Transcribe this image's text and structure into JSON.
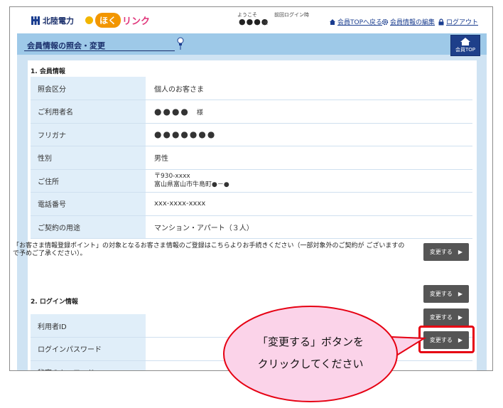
{
  "header": {
    "company": "北陸電力",
    "brand_badge": "ほく",
    "brand_rest": "リンク",
    "welcome": "ようこそ",
    "user_masked": "●●●●",
    "user_suffix": "様",
    "last_login_label": "前回ログイン時",
    "links": {
      "member_top": "会員TOPへ戻る",
      "edit_member": "会員情報の編集",
      "logout": "ログアウト"
    }
  },
  "page": {
    "title": "会員情報の照会・変更",
    "top_button": "会員TOP"
  },
  "section1": {
    "title": "1. 会員情報",
    "rows": [
      {
        "label": "照会区分",
        "value": "個人のお客さま"
      },
      {
        "label": "ご利用者名",
        "value": "●●●●",
        "suffix": "様"
      },
      {
        "label": "フリガナ",
        "value": "●●●●●●●"
      },
      {
        "label": "性別",
        "value": "男性"
      },
      {
        "label": "ご住所",
        "value_line1": "〒930-xxxx",
        "value_line2": "富山県富山市牛島町●－●"
      },
      {
        "label": "電話番号",
        "value": "xxx-xxxx-xxxx"
      },
      {
        "label": "ご契約の用途",
        "value": "マンション・アパート（３人）"
      }
    ],
    "notice": "「お客さま情報登録ポイント」の対象となるお客さま情報のご登録はこちらよりお手続きください（一部対象外のご契約が ございますので予めご了承ください）。"
  },
  "section2": {
    "title": "2. ログイン情報",
    "rows": [
      {
        "label": "利用者ID"
      },
      {
        "label": "ログインパスワード"
      },
      {
        "label": "秘密のキーワード"
      }
    ]
  },
  "buttons": {
    "change": "変更する"
  },
  "callout": {
    "line1": "「変更する」ボタンを",
    "line2": "クリックしてください"
  },
  "colors": {
    "accent_red": "#e60012",
    "band_blue": "#cfe3f3",
    "title_blue": "#9ec9e8",
    "navy": "#1a2f6b",
    "bubble_pink": "#fbd3e9"
  }
}
